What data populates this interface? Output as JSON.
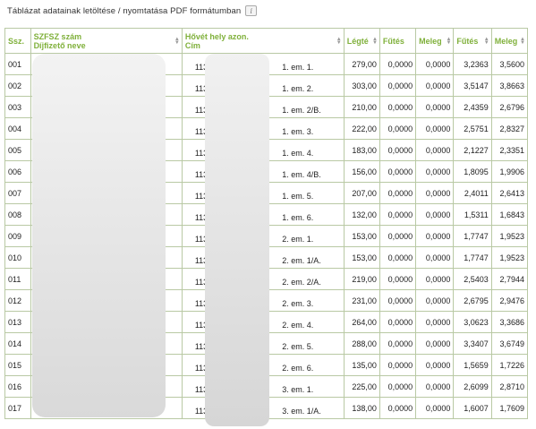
{
  "header": {
    "title": "Táblázat adatainak letöltése / nyomtatása PDF formátumban",
    "info_icon": "info-icon"
  },
  "table": {
    "columns": {
      "ssz": "Ssz.",
      "szfsz_line1": "SZFSZ szám",
      "szfsz_line2": "Díjfizető neve",
      "hely_line1": "Hővét hely azon.",
      "hely_line2": "Cím",
      "legter": "Légté",
      "futes1": "Fűtés",
      "meleg1": "Meleg",
      "futes2": "Fűtés",
      "meleg2": "Meleg"
    },
    "rows": [
      {
        "ssz": "001",
        "hely_code": "1136",
        "hely_addr": "1. em. 1.",
        "legter": "279,00",
        "futes1": "0,0000",
        "meleg1": "0,0000",
        "futes2": "3,2363",
        "meleg2": "3,5600"
      },
      {
        "ssz": "002",
        "hely_code": "1136",
        "hely_addr": "1. em. 2.",
        "legter": "303,00",
        "futes1": "0,0000",
        "meleg1": "0,0000",
        "futes2": "3,5147",
        "meleg2": "3,8663"
      },
      {
        "ssz": "003",
        "hely_code": "1136",
        "hely_addr": "1. em. 2/B.",
        "legter": "210,00",
        "futes1": "0,0000",
        "meleg1": "0,0000",
        "futes2": "2,4359",
        "meleg2": "2,6796"
      },
      {
        "ssz": "004",
        "hely_code": "1136",
        "hely_addr": "1. em. 3.",
        "legter": "222,00",
        "futes1": "0,0000",
        "meleg1": "0,0000",
        "futes2": "2,5751",
        "meleg2": "2,8327"
      },
      {
        "ssz": "005",
        "hely_code": "1136",
        "hely_addr": "1. em. 4.",
        "legter": "183,00",
        "futes1": "0,0000",
        "meleg1": "0,0000",
        "futes2": "2,1227",
        "meleg2": "2,3351"
      },
      {
        "ssz": "006",
        "hely_code": "1136",
        "hely_addr": "1. em. 4/B.",
        "legter": "156,00",
        "futes1": "0,0000",
        "meleg1": "0,0000",
        "futes2": "1,8095",
        "meleg2": "1,9906"
      },
      {
        "ssz": "007",
        "hely_code": "1136",
        "hely_addr": "1. em. 5.",
        "legter": "207,00",
        "futes1": "0,0000",
        "meleg1": "0,0000",
        "futes2": "2,4011",
        "meleg2": "2,6413"
      },
      {
        "ssz": "008",
        "hely_code": "1136",
        "hely_addr": "1. em. 6.",
        "legter": "132,00",
        "futes1": "0,0000",
        "meleg1": "0,0000",
        "futes2": "1,5311",
        "meleg2": "1,6843"
      },
      {
        "ssz": "009",
        "hely_code": "1136",
        "hely_addr": "2. em. 1.",
        "legter": "153,00",
        "futes1": "0,0000",
        "meleg1": "0,0000",
        "futes2": "1,7747",
        "meleg2": "1,9523"
      },
      {
        "ssz": "010",
        "hely_code": "1136",
        "hely_addr": "2. em. 1/A.",
        "legter": "153,00",
        "futes1": "0,0000",
        "meleg1": "0,0000",
        "futes2": "1,7747",
        "meleg2": "1,9523"
      },
      {
        "ssz": "011",
        "hely_code": "1136",
        "hely_addr": "2. em. 2/A.",
        "legter": "219,00",
        "futes1": "0,0000",
        "meleg1": "0,0000",
        "futes2": "2,5403",
        "meleg2": "2,7944"
      },
      {
        "ssz": "012",
        "hely_code": "1136",
        "hely_addr": "2. em. 3.",
        "legter": "231,00",
        "futes1": "0,0000",
        "meleg1": "0,0000",
        "futes2": "2,6795",
        "meleg2": "2,9476"
      },
      {
        "ssz": "013",
        "hely_code": "1136",
        "hely_addr": "2. em. 4.",
        "legter": "264,00",
        "futes1": "0,0000",
        "meleg1": "0,0000",
        "futes2": "3,0623",
        "meleg2": "3,3686"
      },
      {
        "ssz": "014",
        "hely_code": "1136",
        "hely_addr": "2. em. 5.",
        "legter": "288,00",
        "futes1": "0,0000",
        "meleg1": "0,0000",
        "futes2": "3,3407",
        "meleg2": "3,6749"
      },
      {
        "ssz": "015",
        "hely_code": "1136",
        "hely_addr": "2. em. 6.",
        "legter": "135,00",
        "futes1": "0,0000",
        "meleg1": "0,0000",
        "futes2": "1,5659",
        "meleg2": "1,7226"
      },
      {
        "ssz": "016",
        "hely_code": "1136",
        "hely_addr": "3. em. 1.",
        "legter": "225,00",
        "futes1": "0,0000",
        "meleg1": "0,0000",
        "futes2": "2,6099",
        "meleg2": "2,8710"
      },
      {
        "ssz": "017",
        "hely_code": "1136",
        "hely_addr": "3. em. 1/A.",
        "legter": "138,00",
        "futes1": "0,0000",
        "meleg1": "0,0000",
        "futes2": "1,6007",
        "meleg2": "1,7609"
      }
    ]
  },
  "colors": {
    "header_text": "#7fb03a",
    "border": "#b9c9a4"
  }
}
